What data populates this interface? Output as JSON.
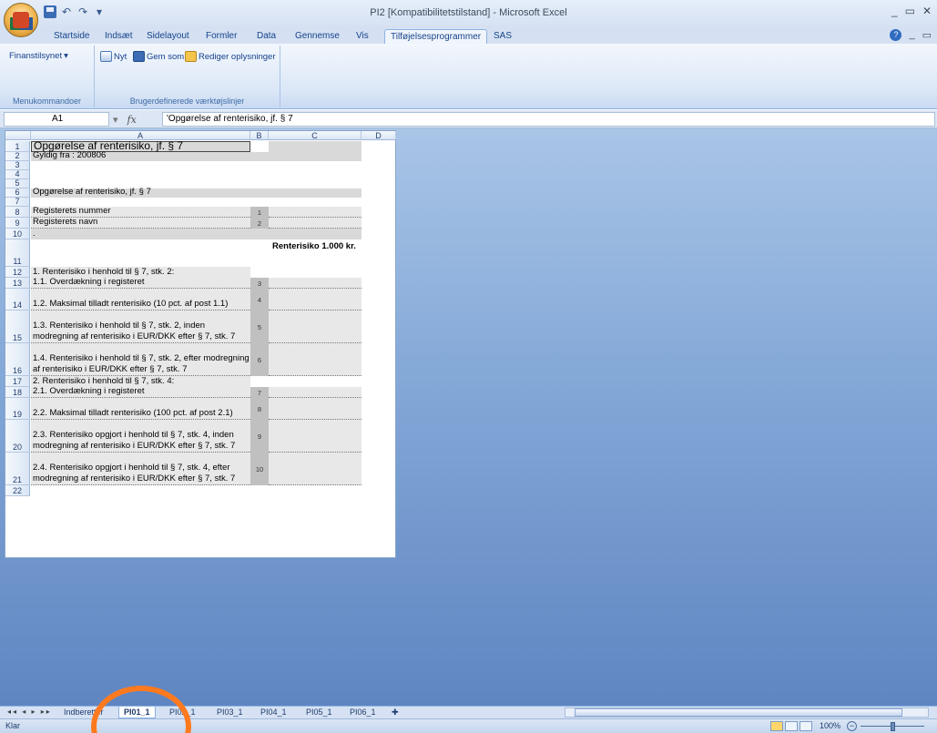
{
  "window": {
    "title": "PI2 [Kompatibilitetstilstand] - Microsoft Excel",
    "controls": [
      "_",
      "▭",
      "✕"
    ]
  },
  "ribbon": {
    "tabs": [
      "Startside",
      "Indsæt",
      "Sidelayout",
      "Formler",
      "Data",
      "Gennemse",
      "Vis",
      "Tilføjelsesprogrammer",
      "SAS"
    ],
    "active_tab": "Tilføjelsesprogrammer",
    "groups": {
      "menu": {
        "label": "Menukommandoer",
        "button": "Finanstilsynet"
      },
      "toolbars": {
        "label": "Brugerdefinerede værktøjslinjer",
        "buttons": [
          "Nyt",
          "Gem som",
          "Rediger oplysninger"
        ]
      }
    }
  },
  "formula_bar": {
    "name_box": "A1",
    "fx": "fx",
    "formula": "'Opgørelse af renterisiko, jf. § 7"
  },
  "sheet": {
    "columns": [
      "A",
      "B",
      "C",
      "D"
    ],
    "rows": [
      {
        "n": "1",
        "a": "Opgørelse af renterisiko, jf. § 7",
        "b": "",
        "c": ""
      },
      {
        "n": "2",
        "a": "Gyldig fra : 200806",
        "b": "",
        "c": ""
      },
      {
        "n": "3",
        "a": "",
        "b": "",
        "c": ""
      },
      {
        "n": "4",
        "a": "",
        "b": "",
        "c": ""
      },
      {
        "n": "5",
        "a": "",
        "b": "",
        "c": ""
      },
      {
        "n": "6",
        "a": "Opgørelse af renterisiko, jf. § 7",
        "b": "",
        "c": ""
      },
      {
        "n": "7",
        "a": "",
        "b": "",
        "c": ""
      },
      {
        "n": "8",
        "a": "Registerets nummer",
        "b": "1",
        "c": ""
      },
      {
        "n": "9",
        "a": "Registerets navn",
        "b": "2",
        "c": ""
      },
      {
        "n": "10",
        "a": ".",
        "b": "",
        "c": ""
      },
      {
        "n": "11",
        "a": "",
        "b": "",
        "c": "Renterisiko 1.000 kr."
      },
      {
        "n": "12",
        "a": "1. Renterisiko i henhold til § 7, stk. 2:",
        "b": "",
        "c": ""
      },
      {
        "n": "13",
        "a": "1.1. Overdækning i registeret",
        "b": "3",
        "c": ""
      },
      {
        "n": "14",
        "a": "1.2. Maksimal tilladt renterisiko (10 pct. af post 1.1)",
        "b": "4",
        "c": ""
      },
      {
        "n": "15",
        "a": "1.3. Renterisiko i henhold til § 7, stk. 2, inden modregning af renterisiko i EUR/DKK efter § 7, stk. 7",
        "b": "5",
        "c": ""
      },
      {
        "n": "16",
        "a": "1.4. Renterisiko i henhold til § 7, stk. 2, efter modregning af renterisiko i EUR/DKK efter § 7, stk. 7",
        "b": "6",
        "c": ""
      },
      {
        "n": "17",
        "a": "2. Renterisiko i henhold til § 7, stk. 4:",
        "b": "",
        "c": ""
      },
      {
        "n": "18",
        "a": "2.1. Overdækning i registeret",
        "b": "7",
        "c": ""
      },
      {
        "n": "19",
        "a": "2.2. Maksimal tilladt renterisiko (100 pct. af post 2.1)",
        "b": "8",
        "c": ""
      },
      {
        "n": "20",
        "a": "2.3. Renterisiko opgjort i henhold til § 7, stk. 4, inden modregning af renterisiko i EUR/DKK efter § 7, stk. 7",
        "b": "9",
        "c": ""
      },
      {
        "n": "21",
        "a": "2.4. Renterisiko opgjort i henhold til § 7, stk. 4, efter modregning af renterisiko i EUR/DKK efter § 7, stk. 7",
        "b": "10",
        "c": ""
      },
      {
        "n": "22",
        "a": "",
        "b": "",
        "c": ""
      }
    ]
  },
  "sheet_tabs": {
    "nav": "◂◂ ◂ ▸ ▸▸",
    "tabs": [
      "Indberetter",
      "PI01_1",
      "PI02_1",
      "PI03_1",
      "PI04_1",
      "PI05_1",
      "PI06_1"
    ],
    "active": "PI01_1"
  },
  "status": {
    "text": "Klar",
    "zoom": "100%",
    "zoom_out": "−"
  },
  "colors": {
    "highlight": "#ff7a1f",
    "workspace": "#86aad8",
    "cell_grey": "#d9d9d9"
  }
}
